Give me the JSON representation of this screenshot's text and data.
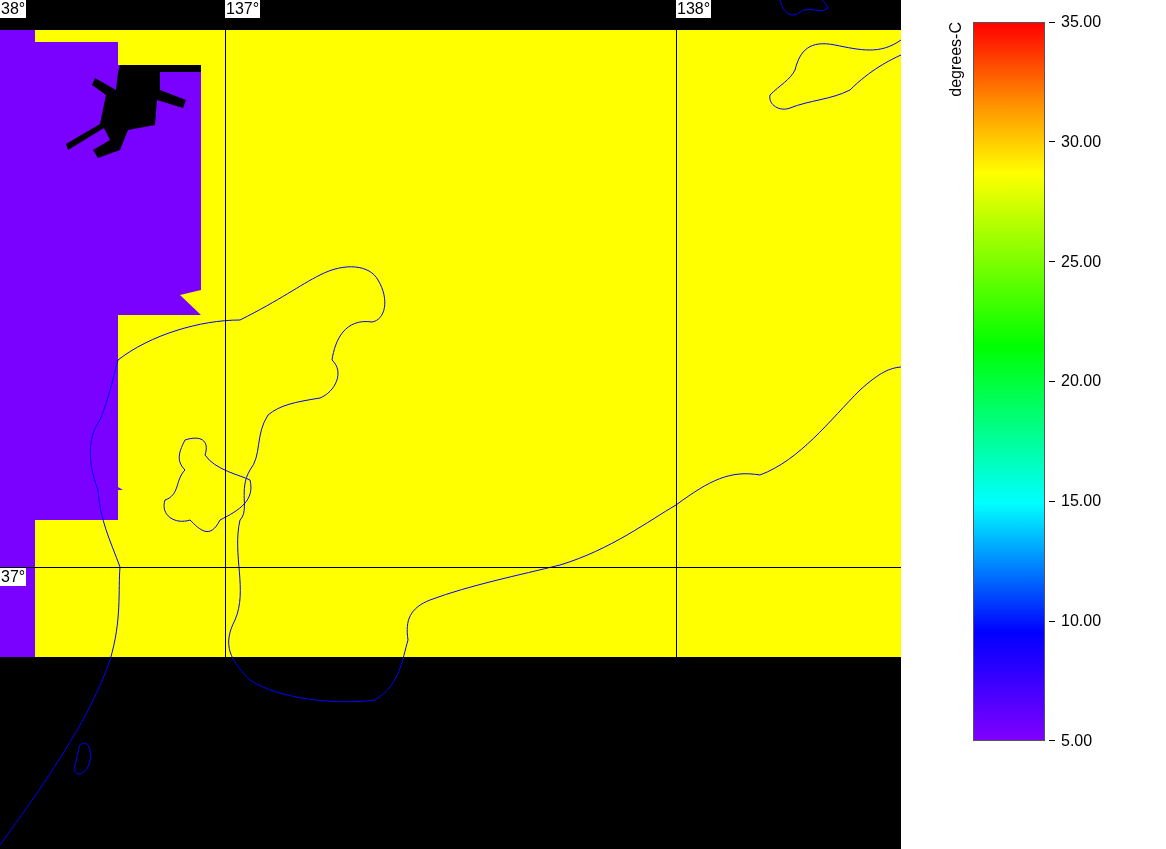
{
  "map": {
    "lat_labels": [
      "38°",
      "37°"
    ],
    "lon_labels": [
      "137°",
      "138°"
    ]
  },
  "colorbar": {
    "unit": "degrees-C",
    "ticks": [
      "35.00",
      "30.00",
      "25.00",
      "20.00",
      "15.00",
      "10.00",
      "5.00"
    ]
  }
}
